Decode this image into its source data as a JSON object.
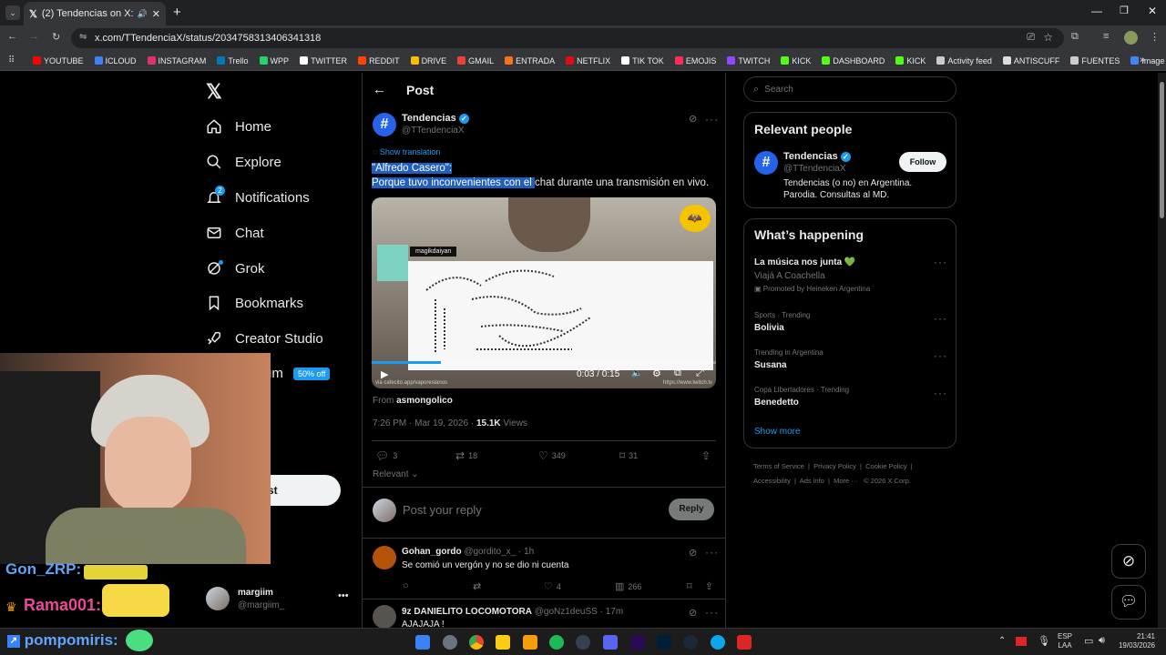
{
  "browser": {
    "tab_title": "(2) Tendencias on X: \"\"Alfre",
    "url": "x.com/TTendenciaX/status/2034758313406341318",
    "bookmarks": [
      {
        "label": "YOUTUBE",
        "color": "#ff0000"
      },
      {
        "label": "ICLOUD",
        "color": "#3b82f6"
      },
      {
        "label": "INSTAGRAM",
        "color": "#e1306c"
      },
      {
        "label": "Trello",
        "color": "#0079bf"
      },
      {
        "label": "WPP",
        "color": "#25d366"
      },
      {
        "label": "TWITTER",
        "color": "#ffffff"
      },
      {
        "label": "REDDIT",
        "color": "#ff4500"
      },
      {
        "label": "DRIVE",
        "color": "#fbbc04"
      },
      {
        "label": "GMAIL",
        "color": "#ea4335"
      },
      {
        "label": "ENTRADA",
        "color": "#f97316"
      },
      {
        "label": "NETFLIX",
        "color": "#e50914"
      },
      {
        "label": "TIK TOK",
        "color": "#ffffff"
      },
      {
        "label": "EMOJIS",
        "color": "#ff2d55"
      },
      {
        "label": "TWITCH",
        "color": "#9146ff"
      },
      {
        "label": "KICK",
        "color": "#53fc18"
      },
      {
        "label": "DASHBOARD",
        "color": "#53fc18"
      },
      {
        "label": "KICK",
        "color": "#53fc18"
      },
      {
        "label": "Activity feed",
        "color": "#cccccc"
      },
      {
        "label": "ANTISCUFF",
        "color": "#dddddd"
      },
      {
        "label": "FUENTES",
        "color": "#cccccc"
      },
      {
        "label": "Image Resizer | Resi...",
        "color": "#4285f4"
      }
    ]
  },
  "nav": {
    "home": "Home",
    "explore": "Explore",
    "notifications": "Notifications",
    "notif_badge": "2",
    "chat": "Chat",
    "grok": "Grok",
    "bookmarks": "Bookmarks",
    "creator": "Creator Studio",
    "premium_suffix": "um",
    "premium_badge": "50% off",
    "post_suffix": "st",
    "user_name": "margiim",
    "user_handle": "@margiim_"
  },
  "post": {
    "header": "Post",
    "author_name": "Tendencias",
    "author_handle": "@TTendenciaX",
    "show_translation": "Show translation",
    "line1": "\"Alfredo Casero\":",
    "line2_selected": "Porque tuvo inconvenientes con el ",
    "line2_rest": "chat durante una transmisión en vivo.",
    "video_user": "magikdaiyan",
    "video_time": "0:03 / 0:15",
    "video_src_left": "via cafecito.app/vaporesianos",
    "video_src_right": "https://www.twitch.tv",
    "from_label": "From",
    "from_user": "asmongolico",
    "time": "7:26 PM · Mar 19, 2026 · ",
    "views_count": "15.1K",
    "views_label": " Views",
    "replies": "3",
    "reposts": "18",
    "likes": "349",
    "bookmarks": "31",
    "relevant": "Relevant",
    "reply_placeholder": "Post your reply",
    "reply_button": "Reply"
  },
  "replies": [
    {
      "name": "Gohan_gordo",
      "handle": "@gordito_x_ · 1h",
      "text": "Se comió un vergón y no se dio ni cuenta",
      "likes": "4",
      "views": "266"
    },
    {
      "name": "9z DANIELITO LOCOMOTORA",
      "handle": "@goNz1deuSS · 17m",
      "text": "AJAJAJA !"
    }
  ],
  "right": {
    "search_placeholder": "Search",
    "relevant_title": "Relevant people",
    "person_name": "Tendencias",
    "person_handle": "@TTendenciaX",
    "follow": "Follow",
    "person_bio": "Tendencias (o no) en Argentina. Parodia. Consultas al MD.",
    "happening_title": "What’s happening",
    "trends": [
      {
        "ctx": "",
        "title": "La música nos junta 💚",
        "sub": "Viajá A Coachella",
        "promo": "Promoted by Heineken Argentina"
      },
      {
        "ctx": "Sports · Trending",
        "title": "Bolivia"
      },
      {
        "ctx": "Trending in Argentina",
        "title": "Susana"
      },
      {
        "ctx": "Copa Libertadores · Trending",
        "title": "Benedetto"
      }
    ],
    "show_more": "Show more",
    "footer": [
      "Terms of Service",
      "Privacy Policy",
      "Cookie Policy",
      "Accessibility",
      "Ads info",
      "More ···",
      "© 2026 X Corp."
    ]
  },
  "stream_chat": [
    {
      "user": "Gon_ZRP:",
      "color": "#60a5fa"
    },
    {
      "user": "Rama001:",
      "color": "#ec4899"
    },
    {
      "user": "pompomiris:",
      "color": "#60a5fa"
    }
  ],
  "taskbar": {
    "lang": "ESP",
    "lang2": "LAA",
    "time": "21:41",
    "date": "19/03/2026"
  }
}
